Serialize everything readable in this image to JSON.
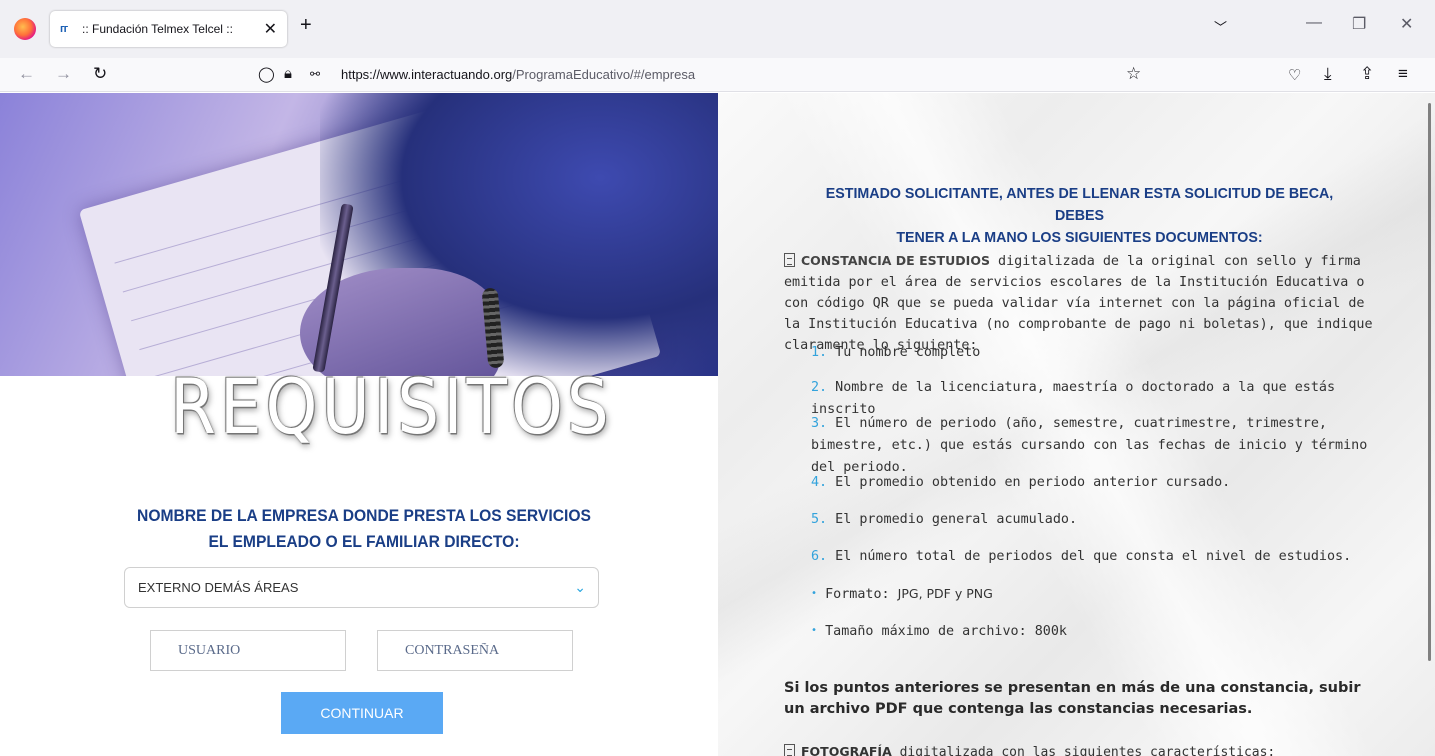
{
  "browser": {
    "tab_title": ":: Fundación Telmex Telcel ::",
    "tab_favicon": "ᴦᴦ",
    "url_host": "https://www.interactuando.org",
    "url_path": "/ProgramaEducativo/#/empresa"
  },
  "left": {
    "hero_title": "REQUISITOS",
    "company_heading_1": "NOMBRE DE LA EMPRESA DONDE PRESTA LOS SERVICIOS",
    "company_heading_2": "EL EMPLEADO O EL FAMILIAR DIRECTO:",
    "company_select_value": "EXTERNO DEMÁS ÁREAS",
    "user_placeholder": "USUARIO",
    "password_placeholder": "CONTRASEÑA",
    "continue_label": "CONTINUAR"
  },
  "right": {
    "heading_1": "ESTIMADO SOLICITANTE, ANTES DE LLENAR ESTA SOLICITUD DE BECA, DEBES",
    "heading_2": "TENER A LA MANO LOS SIGUIENTES DOCUMENTOS:",
    "constancia_title": "CONSTANCIA DE ESTUDIOS",
    "constancia_text": " digitalizada de la original con sello y firma emitida por el área de servicios escolares de la Institución Educativa o con código QR que se pueda validar vía internet con la página oficial de la Institución Educativa (no comprobante de pago ni boletas), que indique claramente lo siguiente:",
    "items": [
      {
        "num": "1.",
        "text": " Tu nombre completo"
      },
      {
        "num": "2.",
        "text": " Nombre de la licenciatura, maestría o doctorado a la que estás inscrito"
      },
      {
        "num": "3.",
        "text": " El número de periodo (año, semestre, cuatrimestre, trimestre, bimestre, etc.) que estás cursando con las fechas de inicio y término del periodo."
      },
      {
        "num": "4.",
        "text": " El promedio obtenido en periodo anterior cursado."
      },
      {
        "num": "5.",
        "text": " El promedio general acumulado."
      },
      {
        "num": "6.",
        "text": " El número total de periodos del que consta el nivel de estudios."
      }
    ],
    "format_label": " Formato: ",
    "format_value": "JPG, PDF y PNG",
    "size_label": " Tamaño máximo de archivo: 800k",
    "bullet": "•",
    "note": "Si los puntos anteriores se presentan en más de una constancia, subir un archivo PDF que contenga las constancias necesarias.",
    "next_title": "FOTOGRAFÍA",
    "next_text": " digitalizada con las siguientes características:"
  }
}
